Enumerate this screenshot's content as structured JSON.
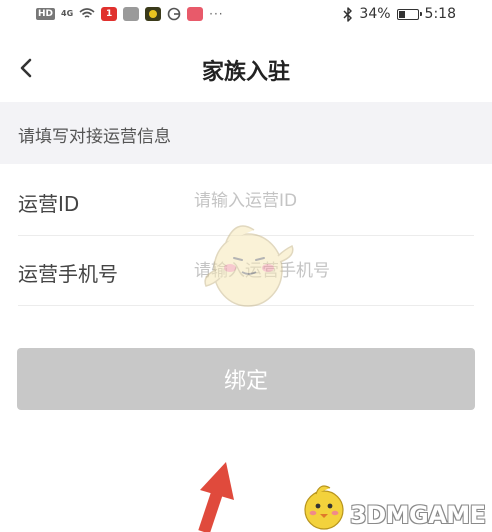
{
  "status_bar": {
    "left_icons": [
      "hd-icon",
      "4g-signal-icon",
      "wifi-icon",
      "app-1-icon",
      "app-nfc-icon",
      "app-badge-icon",
      "app-g-icon",
      "app-red-icon"
    ],
    "hd_label": "HD",
    "signal_label": "4G",
    "more_label": "···",
    "battery_percent_text": "34%",
    "battery_level": 0.34,
    "time": "5:18"
  },
  "header": {
    "back_icon": "chevron-left-icon",
    "title": "家族入驻"
  },
  "section": {
    "title": "请填写对接运营信息"
  },
  "form": {
    "operator_id": {
      "label": "运营ID",
      "value": "",
      "placeholder": "请输入运营ID"
    },
    "operator_phone": {
      "label": "运营手机号",
      "value": "",
      "placeholder": "请输入运营手机号"
    }
  },
  "bind_button": {
    "label": "绑定"
  },
  "watermark": {
    "text": "3DMGAME"
  },
  "colors": {
    "section_bg": "#f3f3f6",
    "button_bg": "#c8c8c8",
    "arrow": "#e04a3c"
  }
}
